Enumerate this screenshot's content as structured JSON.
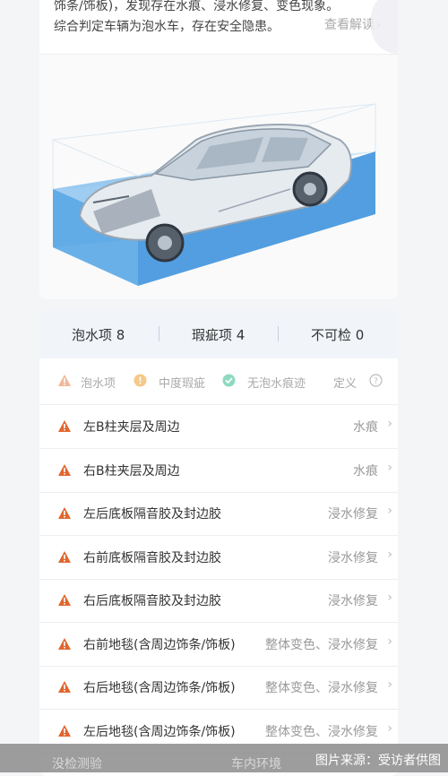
{
  "summary": {
    "text": "饰条/饰板)，发现存在水痕、浸水修复、变色现象。综合判定车辆为泡水车，存在安全隐患。",
    "detail_link": "查看解读"
  },
  "tabs": [
    {
      "label": "泡水项 8"
    },
    {
      "label": "瑕疵项 4"
    },
    {
      "label": "不可检 0"
    }
  ],
  "legend": {
    "soaked": "泡水项",
    "moderate": "中度瑕疵",
    "no_soak": "无泡水痕迹",
    "definition": "定义"
  },
  "items": [
    {
      "label": "左B柱夹层及周边",
      "status": "水痕"
    },
    {
      "label": "右B柱夹层及周边",
      "status": "水痕"
    },
    {
      "label": "左后底板隔音胶及封边胶",
      "status": "浸水修复"
    },
    {
      "label": "右前底板隔音胶及封边胶",
      "status": "浸水修复"
    },
    {
      "label": "右后底板隔音胶及封边胶",
      "status": "浸水修复"
    },
    {
      "label": "右前地毯(含周边饰条/饰板)",
      "status": "整体变色、浸水修复"
    },
    {
      "label": "右后地毯(含周边饰条/饰板)",
      "status": "整体变色、浸水修复"
    },
    {
      "label": "左后地毯(含周边饰条/饰板)",
      "status": "整体变色、浸水修复"
    }
  ],
  "bottom": {
    "left_partial": "没检测验",
    "mid_partial": "车内环境",
    "credit": "图片来源：受访者供图"
  },
  "colors": {
    "warning": "#e0662e",
    "moderate": "#f1b24a",
    "ok": "#3ec29a",
    "water": "#5aa7e6"
  }
}
